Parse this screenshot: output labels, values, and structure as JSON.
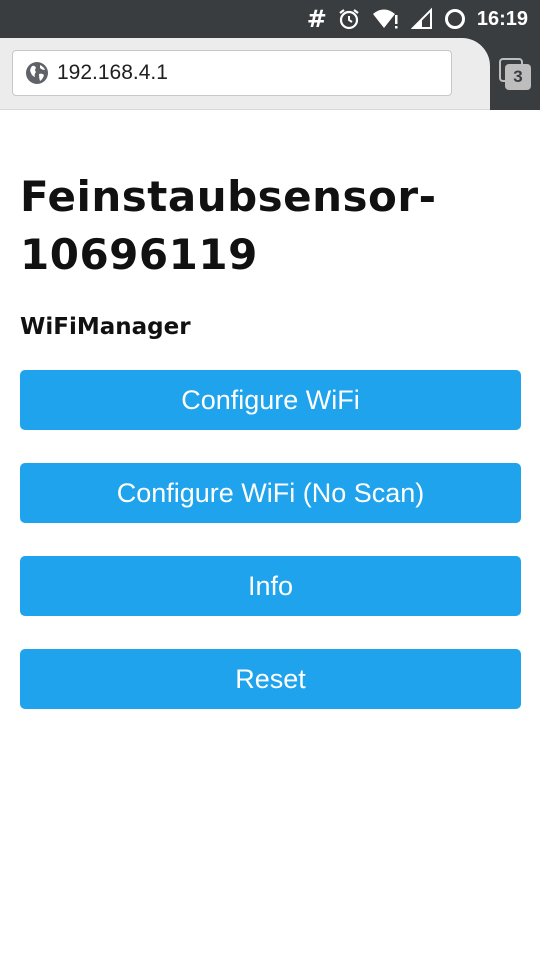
{
  "status_bar": {
    "hash_symbol": "#",
    "icons": [
      "alarm-icon",
      "wifi-icon",
      "signal-icon",
      "sync-icon"
    ],
    "time": "16:19"
  },
  "browser": {
    "url": "192.168.4.1",
    "tab_count": "3"
  },
  "page": {
    "title": "Feinstaubsensor-10696119",
    "subtitle": "WiFiManager",
    "buttons": [
      {
        "label": "Configure WiFi"
      },
      {
        "label": "Configure WiFi (No Scan)"
      },
      {
        "label": "Info"
      },
      {
        "label": "Reset"
      }
    ]
  },
  "colors": {
    "status_bar": "#3a3d40",
    "toolbar": "#ececec",
    "button": "#1fa3ec",
    "button_text": "#ffffff"
  }
}
